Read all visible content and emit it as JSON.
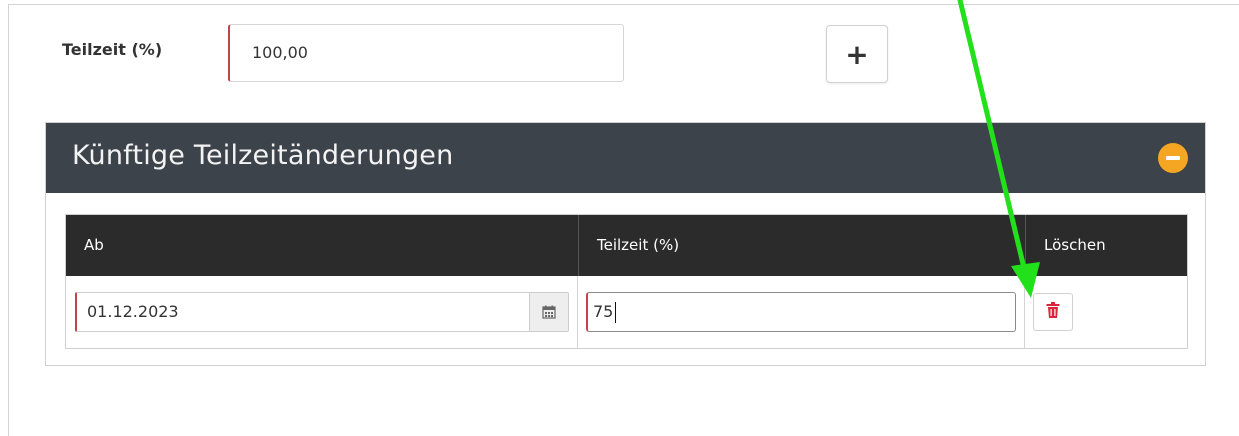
{
  "form": {
    "label": "Teilzeit (%)",
    "value": "100,00",
    "add_label": "+"
  },
  "panel": {
    "title": "Künftige Teilzeitänderungen"
  },
  "table": {
    "headers": [
      "Ab",
      "Teilzeit (%)",
      "Löschen"
    ],
    "rows": [
      {
        "ab": "01.12.2023",
        "teilzeit": "75"
      }
    ]
  },
  "icons": {
    "add": "plus-icon",
    "collapse": "minus-circle-icon",
    "calendar": "calendar-icon",
    "delete": "trash-icon",
    "annotation": "arrow-icon"
  },
  "colors": {
    "header_bg": "#3d434a",
    "table_header_bg": "#2b2b2b",
    "collapse_btn": "#f5a623",
    "delete_icon": "#d9263c",
    "required_border": "#c0444a",
    "annotation_arrow": "#22e01a"
  }
}
